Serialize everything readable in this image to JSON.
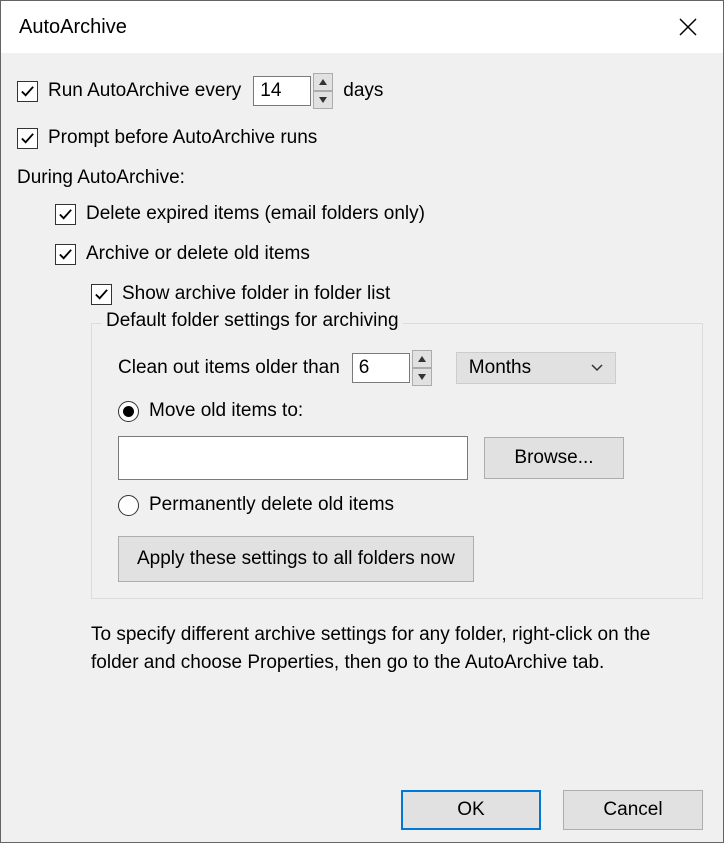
{
  "title": "AutoArchive",
  "run_every": {
    "label_prefix": "Run AutoArchive every",
    "value": "14",
    "label_suffix": "days"
  },
  "prompt_label": "Prompt before AutoArchive runs",
  "during_label": "During AutoArchive:",
  "delete_expired_label": "Delete expired items (email folders only)",
  "archive_delete_label": "Archive or delete old items",
  "show_folder_label": "Show archive folder in folder list",
  "defaults": {
    "legend": "Default folder settings for archiving",
    "clean_out_label": "Clean out items older than",
    "clean_out_value": "6",
    "unit_selected": "Months",
    "move_label": "Move old items to:",
    "move_path": "",
    "browse_label": "Browse...",
    "delete_label": "Permanently delete old items",
    "apply_label": "Apply these settings to all folders now"
  },
  "info": "To specify different archive settings for any folder, right-click on the folder and choose Properties, then go to the AutoArchive tab.",
  "buttons": {
    "ok": "OK",
    "cancel": "Cancel"
  }
}
